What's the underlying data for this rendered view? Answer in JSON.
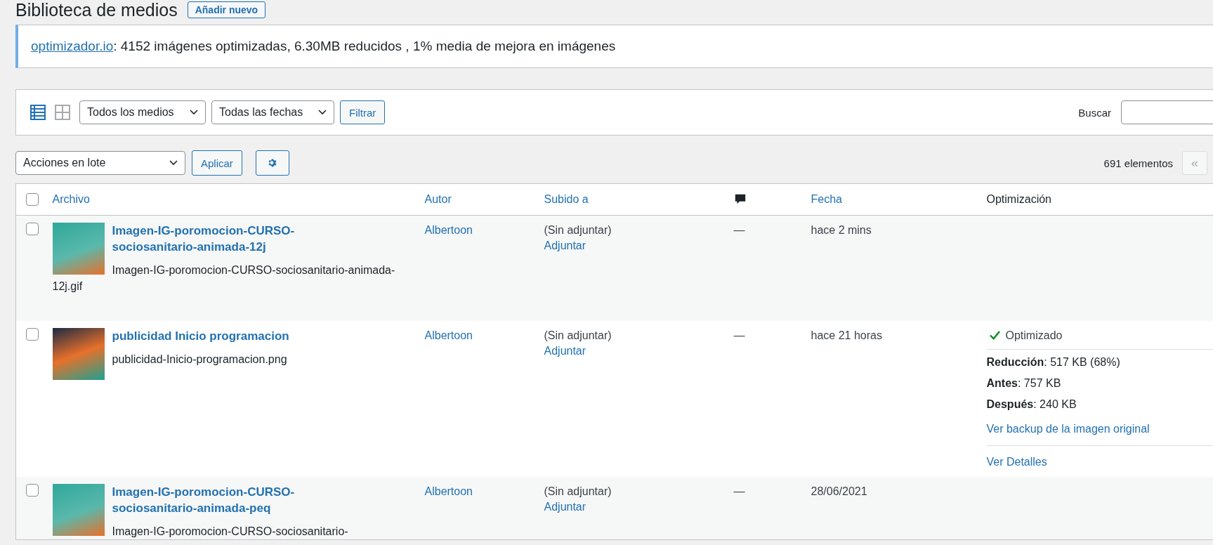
{
  "page": {
    "title": "Biblioteca de medios",
    "add_button": "Añadir nuevo"
  },
  "notice": {
    "link": "optimizador.io",
    "text": ": 4152 imágenes optimizadas, 6.30MB reducidos , 1% media de mejora en imágenes"
  },
  "view_modes": [
    {
      "kind": "list",
      "selected": true
    },
    {
      "kind": "grid",
      "selected": false
    }
  ],
  "filters": {
    "media_type": "Todos los medios",
    "dates": "Todas las fechas",
    "filter_button": "Filtrar",
    "search_label": "Buscar"
  },
  "bulk": {
    "action": "Acciones en lote",
    "apply_button": "Aplicar",
    "count": "691 elementos",
    "first_page": {
      "label": "«",
      "disabled": true
    }
  },
  "table": {
    "select_all_checked": false,
    "columns": [
      {
        "kind": "text",
        "label": "Archivo",
        "sortable": true
      },
      {
        "kind": "text",
        "label": "Autor",
        "sortable": true
      },
      {
        "kind": "text",
        "label": "Subido a",
        "sortable": true
      },
      {
        "kind": "icon",
        "sortable": false
      },
      {
        "kind": "text",
        "label": "Fecha",
        "sortable": true
      },
      {
        "kind": "text",
        "label": "Optimización",
        "sortable": false
      }
    ],
    "rows": [
      {
        "checked": false,
        "title": "Imagen-IG-poromocion-CURSO-sociosanitario-animada-12j",
        "filename": "Imagen-IG-poromocion-CURSO-sociosanitario-animada-12j.gif",
        "author": "Albertoon",
        "attached": "(Sin adjuntar)",
        "attach_link": "Adjuntar",
        "comments": "—",
        "date": "hace 2 mins"
      },
      {
        "checked": false,
        "title": "publicidad Inicio programacion",
        "filename": "publicidad-Inicio-programacion.png",
        "author": "Albertoon",
        "attached": "(Sin adjuntar)",
        "attach_link": "Adjuntar",
        "comments": "—",
        "date": "hace 21 horas",
        "optimization": {
          "status": "Optimizado",
          "details": [
            "**Reducción**: 517 KB (68%)",
            "**Antes**: 757 KB",
            "**Después**: 240 KB"
          ],
          "backup_link": "Ver backup de la imagen original",
          "details_link": "Ver Detalles"
        }
      },
      {
        "checked": false,
        "title": "Imagen-IG-poromocion-CURSO-sociosanitario-animada-peq",
        "filename": "Imagen-IG-poromocion-CURSO-sociosanitario-",
        "author": "Albertoon",
        "attached": "(Sin adjuntar)",
        "attach_link": "Adjuntar",
        "comments": "—",
        "date": "28/06/2021"
      }
    ]
  }
}
